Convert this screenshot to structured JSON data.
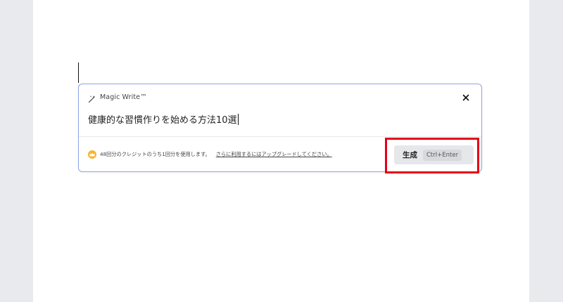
{
  "magic_write": {
    "title": "Magic Write™",
    "prompt_text": "健康的な習慣作りを始める方法10選",
    "credits_text": "48回分のクレジットのうち1回分を使用します。",
    "upgrade_link": "さらに利用するにはアップグレードしてください。",
    "generate_label": "生成",
    "shortcut_label": "Ctrl+Enter"
  },
  "icons": {
    "header": "magic-wand-icon",
    "close": "close-icon",
    "credits": "crown-icon"
  },
  "colors": {
    "panel_border": "#8fa4ee",
    "crown": "#f5b72a",
    "highlight": "#e6001a",
    "button_bg": "#e6e7ea"
  }
}
